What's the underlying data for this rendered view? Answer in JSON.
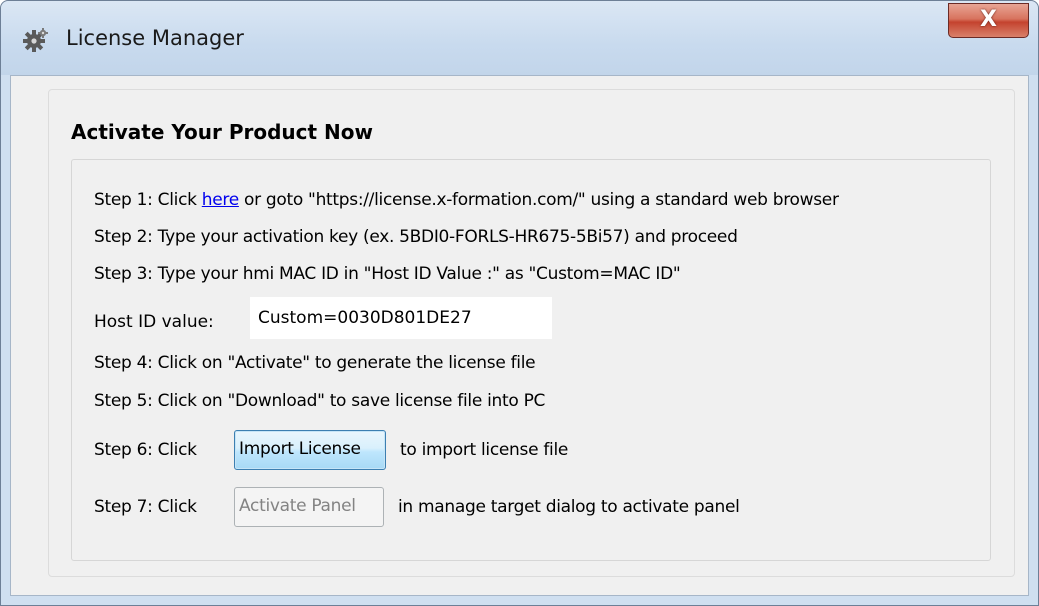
{
  "window": {
    "title": "License Manager",
    "close_label": "X"
  },
  "group": {
    "title": "Activate Your Product Now"
  },
  "steps": {
    "step1_prefix": "Step 1: Click ",
    "step1_link": "here",
    "step1_suffix": " or goto \"https://license.x-formation.com/\" using a standard web browser",
    "step2": "Step 2: Type your activation key (ex. 5BDI0-FORLS-HR675-5Bi57) and proceed",
    "step3": "Step 3: Type your hmi MAC ID in \"Host ID Value :\" as \"Custom=MAC ID\"",
    "host_label": "Host ID value:",
    "host_value": "Custom=0030D801DE27",
    "step4": "Step 4: Click on \"Activate\" to generate the license file",
    "step5": "Step 5: Click on \"Download\" to save  license file into PC",
    "step6_prefix": "Step 6: Click",
    "step6_button": "Import License",
    "step6_suffix": "to import license file",
    "step7_prefix": "Step 7: Click",
    "step7_button": "Activate Panel",
    "step7_suffix": "in manage target dialog to activate panel"
  }
}
